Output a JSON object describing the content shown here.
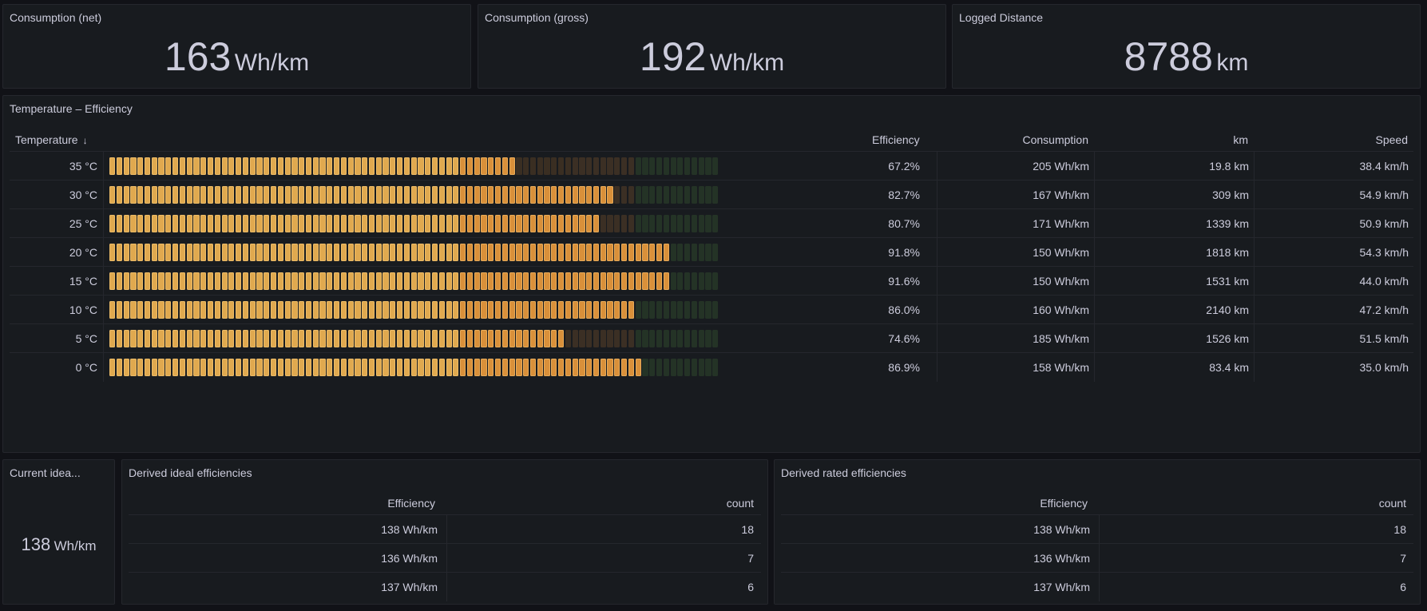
{
  "stats": {
    "net": {
      "title": "Consumption (net)",
      "value": "163",
      "unit": "Wh/km"
    },
    "gross": {
      "title": "Consumption (gross)",
      "value": "192",
      "unit": "Wh/km"
    },
    "distance": {
      "title": "Logged Distance",
      "value": "8788",
      "unit": "km"
    }
  },
  "temp_panel": {
    "title": "Temperature – Efficiency",
    "columns": {
      "temperature": "Temperature",
      "sort_icon": "↓",
      "efficiency": "Efficiency",
      "consumption": "Consumption",
      "km": "km",
      "speed": "Speed"
    },
    "rows": [
      {
        "temperature": "35 °C",
        "efficiency": "67.2%",
        "fill": 0.672,
        "consumption": "205 Wh/km",
        "km": "19.8 km",
        "speed": "38.4 km/h"
      },
      {
        "temperature": "30 °C",
        "efficiency": "82.7%",
        "fill": 0.827,
        "consumption": "167 Wh/km",
        "km": "309 km",
        "speed": "54.9 km/h"
      },
      {
        "temperature": "25 °C",
        "efficiency": "80.7%",
        "fill": 0.807,
        "consumption": "171 Wh/km",
        "km": "1339 km",
        "speed": "50.9 km/h"
      },
      {
        "temperature": "20 °C",
        "efficiency": "91.8%",
        "fill": 0.918,
        "consumption": "150 Wh/km",
        "km": "1818 km",
        "speed": "54.3 km/h"
      },
      {
        "temperature": "15 °C",
        "efficiency": "91.6%",
        "fill": 0.916,
        "consumption": "150 Wh/km",
        "km": "1531 km",
        "speed": "44.0 km/h"
      },
      {
        "temperature": "10 °C",
        "efficiency": "86.0%",
        "fill": 0.86,
        "consumption": "160 Wh/km",
        "km": "2140 km",
        "speed": "47.2 km/h"
      },
      {
        "temperature": "5 °C",
        "efficiency": "74.6%",
        "fill": 0.746,
        "consumption": "185 Wh/km",
        "km": "1526 km",
        "speed": "51.5 km/h"
      },
      {
        "temperature": "0 °C",
        "efficiency": "86.9%",
        "fill": 0.869,
        "consumption": "158 Wh/km",
        "km": "83.4 km",
        "speed": "35.0 km/h"
      }
    ],
    "colors": {
      "filled": "#e0a94f",
      "filled_high": "#d9903a",
      "empty_low": "#3a2e22",
      "empty_mid": "#3b2f24",
      "empty_high": "#243326"
    }
  },
  "current_ideal": {
    "title": "Current idea...",
    "value": "138",
    "unit": "Wh/km"
  },
  "derived_ideal": {
    "title": "Derived ideal efficiencies",
    "columns": {
      "efficiency": "Efficiency",
      "count": "count"
    },
    "rows": [
      {
        "efficiency": "138 Wh/km",
        "count": "18"
      },
      {
        "efficiency": "136 Wh/km",
        "count": "7"
      },
      {
        "efficiency": "137 Wh/km",
        "count": "6"
      }
    ]
  },
  "derived_rated": {
    "title": "Derived rated efficiencies",
    "columns": {
      "efficiency": "Efficiency",
      "count": "count"
    },
    "rows": [
      {
        "efficiency": "138 Wh/km",
        "count": "18"
      },
      {
        "efficiency": "136 Wh/km",
        "count": "7"
      },
      {
        "efficiency": "137 Wh/km",
        "count": "6"
      }
    ]
  }
}
